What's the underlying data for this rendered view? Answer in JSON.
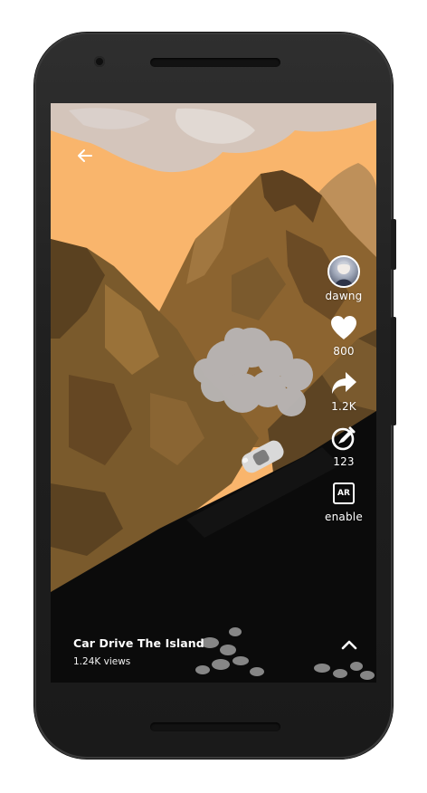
{
  "video": {
    "title": "Car Drive The Island",
    "views": "1.24K views"
  },
  "actions": {
    "profile": {
      "username": "dawng",
      "icon": "avatar"
    },
    "like": {
      "count": "800",
      "icon": "heart-icon"
    },
    "share": {
      "count": "1.2K",
      "icon": "share-arrow-icon"
    },
    "edit": {
      "count": "123",
      "icon": "brush-edit-icon"
    },
    "ar": {
      "badge": "AR",
      "label": "enable",
      "icon": "ar-icon"
    }
  },
  "navigation": {
    "back_icon": "arrow-left-icon",
    "expand_icon": "chevron-up-icon"
  },
  "colors": {
    "sky": "#f9b56c",
    "mountain_light": "#8f6a35",
    "mountain_dark": "#4c3820",
    "road": "#0a0a0a",
    "text": "#ffffff"
  }
}
